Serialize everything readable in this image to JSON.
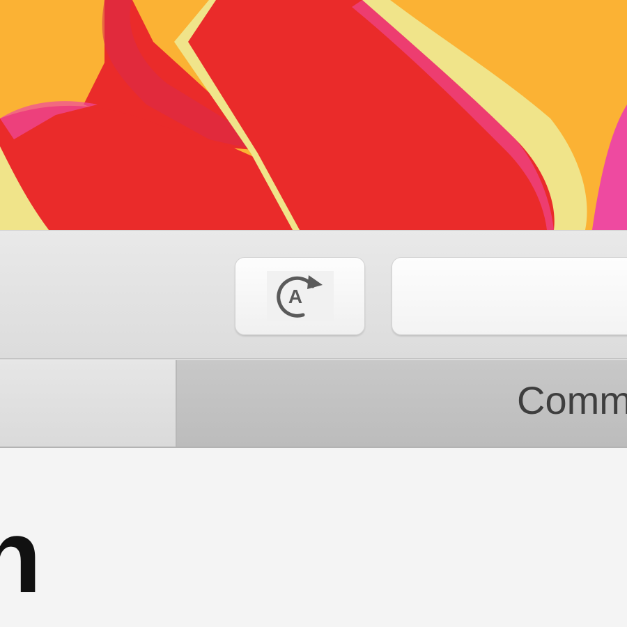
{
  "wallpaper": {
    "background_color": "#fbb234",
    "petal_color": "#ea2b2a",
    "petal_edge_color": "#f0e48a",
    "petal_highlight_color": "#ee4aa0"
  },
  "toolbar": {
    "auto_button": {
      "icon": "circular-arrow-A-icon",
      "icon_letter": "A"
    },
    "search_field": {
      "value": ""
    }
  },
  "tabs": [
    {
      "label": ""
    },
    {
      "label": "Comm"
    }
  ],
  "content": {
    "partial_text": "n"
  }
}
